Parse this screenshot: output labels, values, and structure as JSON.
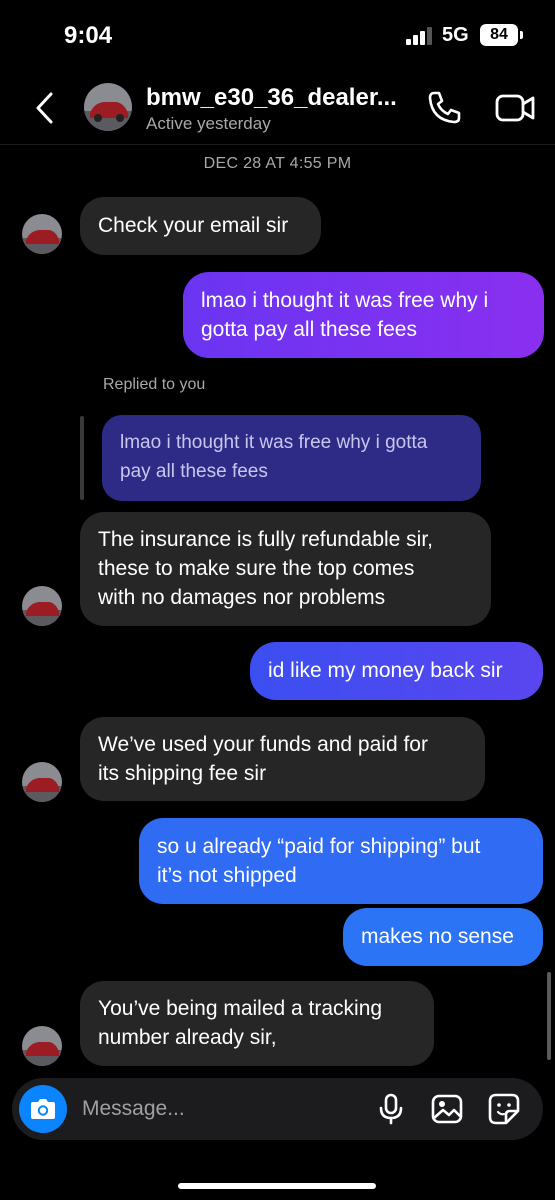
{
  "status_bar": {
    "time": "9:04",
    "network": "5G",
    "battery": "84"
  },
  "header": {
    "name": "bmw_e30_36_dealer...",
    "subtitle": "Active yesterday"
  },
  "date_divider": "DEC 28 AT 4:55 PM",
  "colors": {
    "incoming_bubble": "#262626",
    "outgoing_purple": "#7a2ff0",
    "outgoing_blue": "#2f6bf3",
    "accent_blue": "#0a84ff",
    "reply_quote_bg": "#2e2b86"
  },
  "messages": [
    {
      "direction": "incoming",
      "lines": [
        "Check your email sir"
      ]
    },
    {
      "direction": "outgoing",
      "lines": [
        "lmao i thought it was free why i",
        "gotta pay all these fees"
      ]
    },
    {
      "direction": "incoming",
      "reply_label": "Replied to you",
      "quoted": [
        "lmao i thought it was free why i gotta",
        "pay all these fees"
      ],
      "lines": [
        "The insurance is fully refundable sir,",
        "these to make sure the top comes",
        "with no damages nor problems"
      ]
    },
    {
      "direction": "outgoing",
      "lines": [
        "id like my money back sir"
      ]
    },
    {
      "direction": "incoming",
      "lines": [
        "We’ve used your funds and paid for",
        "its  shipping fee sir"
      ]
    },
    {
      "direction": "outgoing",
      "lines": [
        "so u already “paid for shipping” but",
        "it’s not shipped"
      ]
    },
    {
      "direction": "outgoing",
      "lines": [
        "makes no sense"
      ]
    },
    {
      "direction": "incoming",
      "lines": [
        "You’ve being mailed a tracking",
        "number already sir,"
      ]
    }
  ],
  "composer": {
    "placeholder": "Message..."
  },
  "icons": {
    "back": "chevron-left-icon",
    "call": "phone-icon",
    "video": "video-camera-icon",
    "camera": "camera-icon",
    "mic": "microphone-icon",
    "gallery": "image-icon",
    "sticker": "sticker-icon"
  }
}
